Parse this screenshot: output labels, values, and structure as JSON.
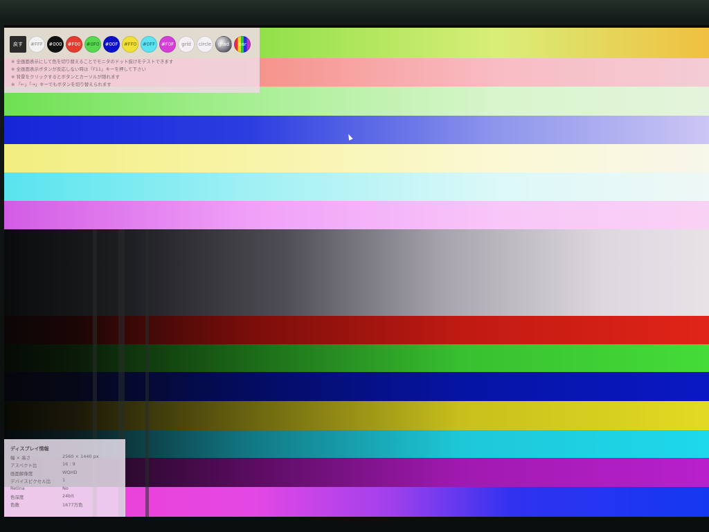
{
  "toolbar": {
    "back_label": "戻す",
    "buttons": [
      {
        "label": "#FFF",
        "bg": "#f2f2f2",
        "fg": "#8a8a8a"
      },
      {
        "label": "#000",
        "bg": "#111111",
        "fg": "#ffffff"
      },
      {
        "label": "#F00",
        "bg": "#e43c30",
        "fg": "#ffffff"
      },
      {
        "label": "#0F0",
        "bg": "#58d850",
        "fg": "#1a5a1a"
      },
      {
        "label": "#00F",
        "bg": "#0a10c8",
        "fg": "#ffffff"
      },
      {
        "label": "#FF0",
        "bg": "#f2e038",
        "fg": "#6a6010"
      },
      {
        "label": "#0FF",
        "bg": "#5ce2f0",
        "fg": "#1a6a74"
      },
      {
        "label": "#F0F",
        "bg": "#d63ed8",
        "fg": "#ffffff"
      },
      {
        "label": "grid",
        "bg": "#f4f0f4",
        "fg": "#8a8a8a"
      },
      {
        "label": "circle",
        "bg": "#f4f0f4",
        "fg": "#8a8a8a"
      },
      {
        "label": "grad",
        "bg": "#8a8890",
        "fg": "#ffffff"
      },
      {
        "label": "bar",
        "bg": "#3a34c8",
        "fg": "#ffffff"
      }
    ]
  },
  "notes": [
    "※ 全画面表示にして色を切り替えることでモニタのドット抜けをテストできます",
    "※ 全画面表示ボタンが反応しない時は「F11」キーを押して下さい",
    "※ 背景をクリックするとボタンとカーソルが隠れます",
    "※ 「←」「→」キーでもボタンを切り替えられます"
  ],
  "display_info": {
    "title": "ディスプレイ情報",
    "rows": [
      {
        "label": "幅 × 高さ",
        "value": "2560 × 1440 px"
      },
      {
        "label": "アスペクト比",
        "value": "16 : 9"
      },
      {
        "label": "画面解像度",
        "value": "WQHD"
      },
      {
        "label": "デバイスピクセル比",
        "value": "1"
      },
      {
        "label": "Retina",
        "value": "No"
      },
      {
        "label": "色深度",
        "value": "24bit"
      },
      {
        "label": "色数",
        "value": "1677万色"
      }
    ]
  },
  "icons": {
    "cursor": "mouse-pointer-icon"
  }
}
